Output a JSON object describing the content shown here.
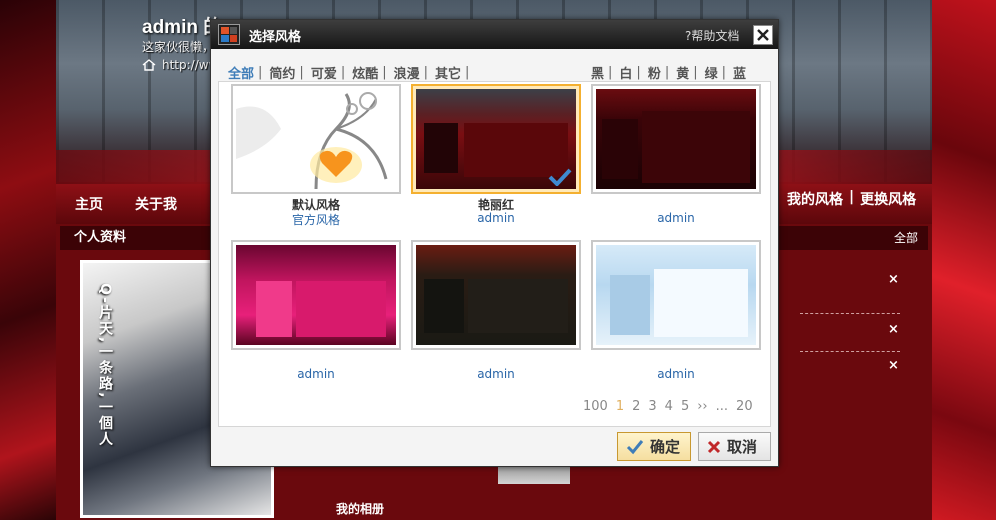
{
  "blog": {
    "title": "admin 的",
    "description": "这家伙很懒，",
    "url": "http://ww",
    "nav": {
      "home": "主页",
      "about": "关于我",
      "my_style": "我的风格",
      "divider": "|",
      "change_style": "更换风格"
    },
    "profile_panel_title": "个人资料",
    "all_link": "全部",
    "profile_caption": "Q-片天,一条路,一個人",
    "album_title": "我的相册",
    "delete_marks": [
      "×",
      "×",
      "×"
    ]
  },
  "dialog": {
    "title": "选择风格",
    "help": "?帮助文档",
    "filters_left": [
      "全部",
      "简约",
      "可爱",
      "炫酷",
      "浪漫",
      "其它"
    ],
    "filters_right": [
      "黑",
      "白",
      "粉",
      "黄",
      "绿",
      "蓝"
    ],
    "separator": "|",
    "themes": [
      {
        "name": "默认风格",
        "author": "官方风格",
        "selected": false
      },
      {
        "name": "艳丽红",
        "author": "admin",
        "selected": true
      },
      {
        "name": "",
        "author": "admin",
        "selected": false
      },
      {
        "name": "",
        "author": "admin",
        "selected": false
      },
      {
        "name": "",
        "author": "admin",
        "selected": false
      },
      {
        "name": "",
        "author": "admin",
        "selected": false
      }
    ],
    "pagination": {
      "first": "100",
      "current": "1",
      "pages": [
        "2",
        "3",
        "4",
        "5"
      ],
      "next": "››",
      "ellipsis": "...",
      "last": "20"
    },
    "buttons": {
      "confirm": "确定",
      "cancel": "取消"
    }
  },
  "colors": {
    "accent_blue": "#3f7db8",
    "selected_border": "#f4b030",
    "page_red": "#6a090d"
  }
}
